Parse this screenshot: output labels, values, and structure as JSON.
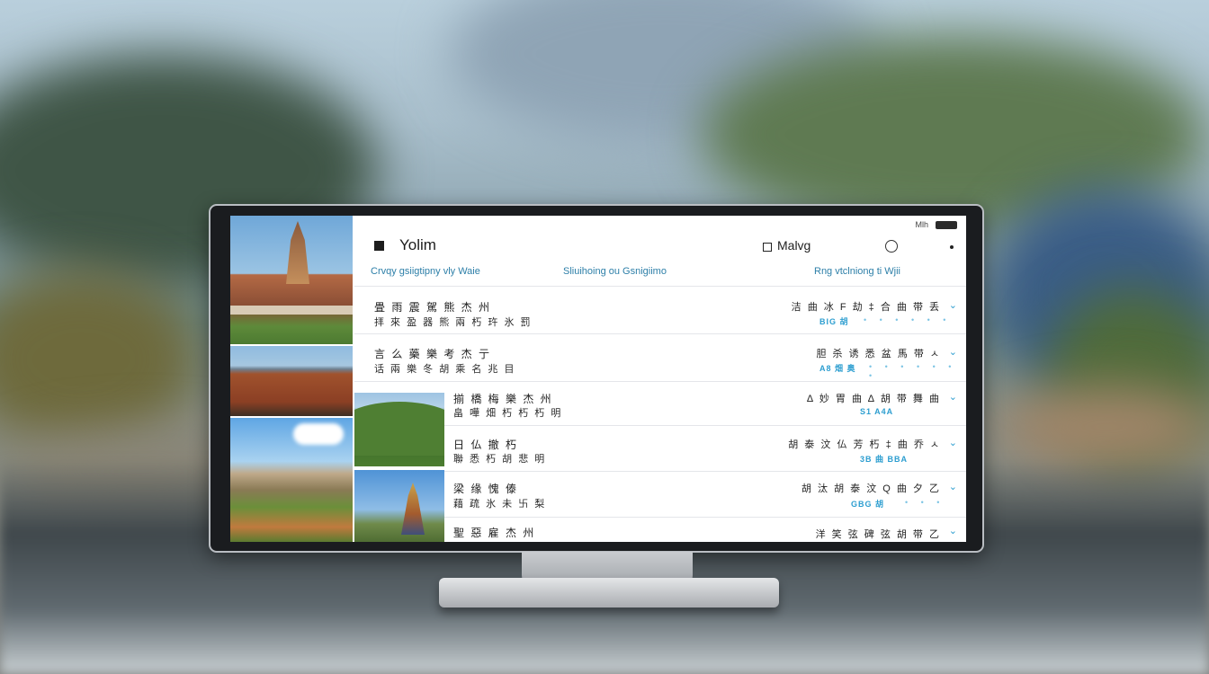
{
  "app": {
    "title": "Yolim",
    "profile_label": "Malvg",
    "status_text": "Mlh",
    "columns": [
      "Crvqy gsiigtipny vly Waie",
      "Sliuihoing ou Gsnigiimo",
      "Rng vtclniong ti Wjii"
    ]
  },
  "rows": [
    {
      "line1": "畳 雨 震 駕 熊 杰 州",
      "line2": "拝 來 盈 器 熊 兩 朽 玝 氷 罰",
      "right1": "洁 曲 冰 F 劫 ‡ 合 曲 带 丢",
      "right2": "BIG 胡",
      "dots": "• • • • • •",
      "chevron": "⌄"
    },
    {
      "line1": "言 么 藥 樂 考 杰 亍",
      "line2": "话 兩 樂 冬 胡 乘 名 兆 目",
      "right1": "胆 杀 诱 悉 盆 馬 带 ㅅ",
      "right2": "A8 畑 奥",
      "dots": "• • • • • • •",
      "chevron": "⌄"
    },
    {
      "line1": "揃 橋 梅 樂 杰 州",
      "line2": "畠 嘩 畑 朽 朽 朽 明",
      "right1": "∆ 妙 胃 曲 ∆ 胡 带 舞 曲",
      "right2": "S1 A4A",
      "dots": "",
      "chevron": "⌄"
    },
    {
      "line1": "日 仏 撤 朽",
      "line2": "聯 悉 朽 胡 悲 明",
      "right1": "胡 泰 汶 仏 芳 朽 ‡ 曲 乔 ㅅ",
      "right2": "3B 曲 BBA",
      "dots": "",
      "chevron": "⌄"
    },
    {
      "line1": "梁 缘 愧 傣",
      "line2": "藉 疏 氷 未 卐 梨",
      "right1": "胡 汰 胡 泰 汶 Q 曲 夕 乙",
      "right2": "GBG 胡",
      "dots": "• • •",
      "chevron": "⌄"
    },
    {
      "line1": "聖 惡 雇 杰 州",
      "line2": "",
      "right1": "洋 笑 弦 碑 弦 胡 带 乙",
      "right2": "",
      "dots": "",
      "chevron": "⌄"
    }
  ],
  "colors": {
    "accent": "#2d9ed0",
    "column_heading": "#2d7fa8",
    "bezel": "#1a1c1f"
  }
}
